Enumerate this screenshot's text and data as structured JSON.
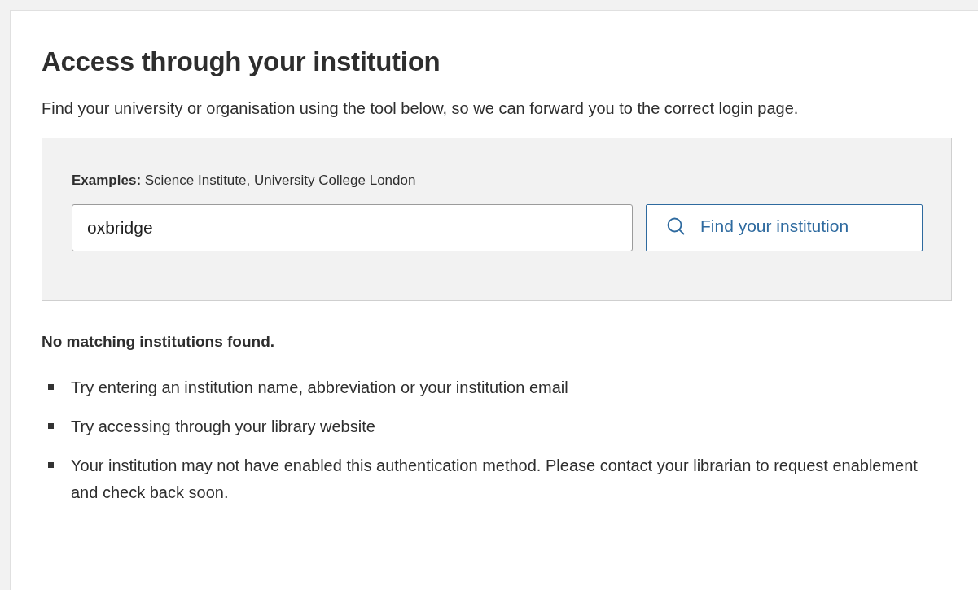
{
  "title": "Access through your institution",
  "intro": "Find your university or organisation using the tool below, so we can forward you to the correct login page.",
  "search": {
    "examples": "**Examples:** Science Institute, University College London",
    "value": "oxbridge",
    "button": "Find your institution"
  },
  "result": {
    "heading": "No matching institutions found.",
    "tips": [
      "Try entering an institution name, abbreviation or your institution email",
      "Try accessing through your library website",
      "Your institution may not have enabled this authentication method. Please contact your librarian to request enablement and check back soon."
    ]
  }
}
